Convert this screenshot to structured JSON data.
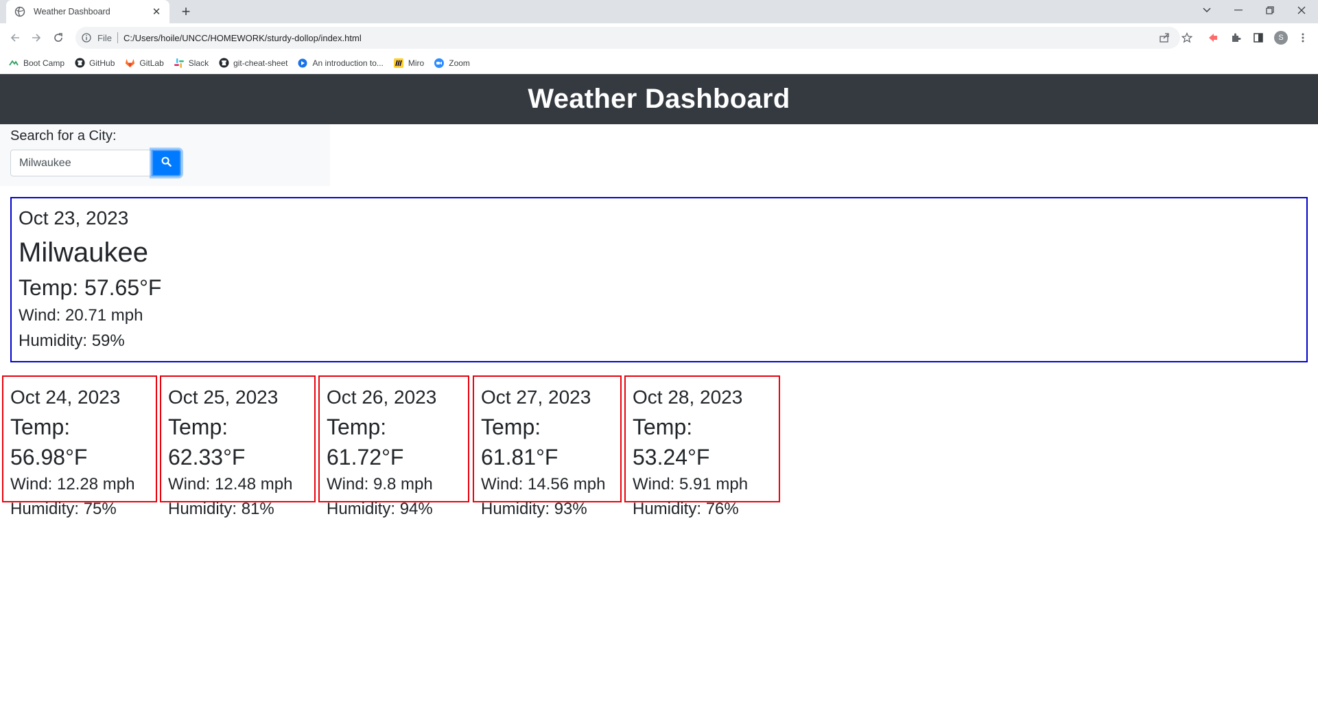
{
  "browser": {
    "tab_title": "Weather Dashboard",
    "url_scheme": "File",
    "url": "C:/Users/hoile/UNCC/HOMEWORK/sturdy-dollop/index.html",
    "profile_initial": "S",
    "bookmarks": [
      {
        "label": "Boot Camp",
        "icon": "bootcamp-icon"
      },
      {
        "label": "GitHub",
        "icon": "github-icon"
      },
      {
        "label": "GitLab",
        "icon": "gitlab-icon"
      },
      {
        "label": "Slack",
        "icon": "slack-icon"
      },
      {
        "label": "git-cheat-sheet",
        "icon": "github-icon"
      },
      {
        "label": "An introduction to...",
        "icon": "play-icon"
      },
      {
        "label": "Miro",
        "icon": "miro-icon"
      },
      {
        "label": "Zoom",
        "icon": "zoom-icon"
      }
    ]
  },
  "header": {
    "title": "Weather Dashboard"
  },
  "search": {
    "label": "Search for a City:",
    "value": "Milwaukee"
  },
  "current": {
    "date": "Oct 23, 2023",
    "city": "Milwaukee",
    "temp": "Temp: 57.65°F",
    "wind": "Wind: 20.71 mph",
    "humidity": "Humidity: 59%"
  },
  "forecast": [
    {
      "date": "Oct 24, 2023",
      "temp": "Temp: 56.98°F",
      "wind": "Wind: 12.28 mph",
      "humidity": "Humidity: 75%"
    },
    {
      "date": "Oct 25, 2023",
      "temp": "Temp: 62.33°F",
      "wind": "Wind: 12.48 mph",
      "humidity": "Humidity: 81%"
    },
    {
      "date": "Oct 26, 2023",
      "temp": "Temp: 61.72°F",
      "wind": "Wind: 9.8 mph",
      "humidity": "Humidity: 94%"
    },
    {
      "date": "Oct 27, 2023",
      "temp": "Temp: 61.81°F",
      "wind": "Wind: 14.56 mph",
      "humidity": "Humidity: 93%"
    },
    {
      "date": "Oct 28, 2023",
      "temp": "Temp: 53.24°F",
      "wind": "Wind: 5.91 mph",
      "humidity": "Humidity: 76%"
    }
  ],
  "colors": {
    "header_bg": "#343a40",
    "search_button": "#007bff",
    "current_border": "#0000cc",
    "forecast_border": "#e8000b"
  }
}
